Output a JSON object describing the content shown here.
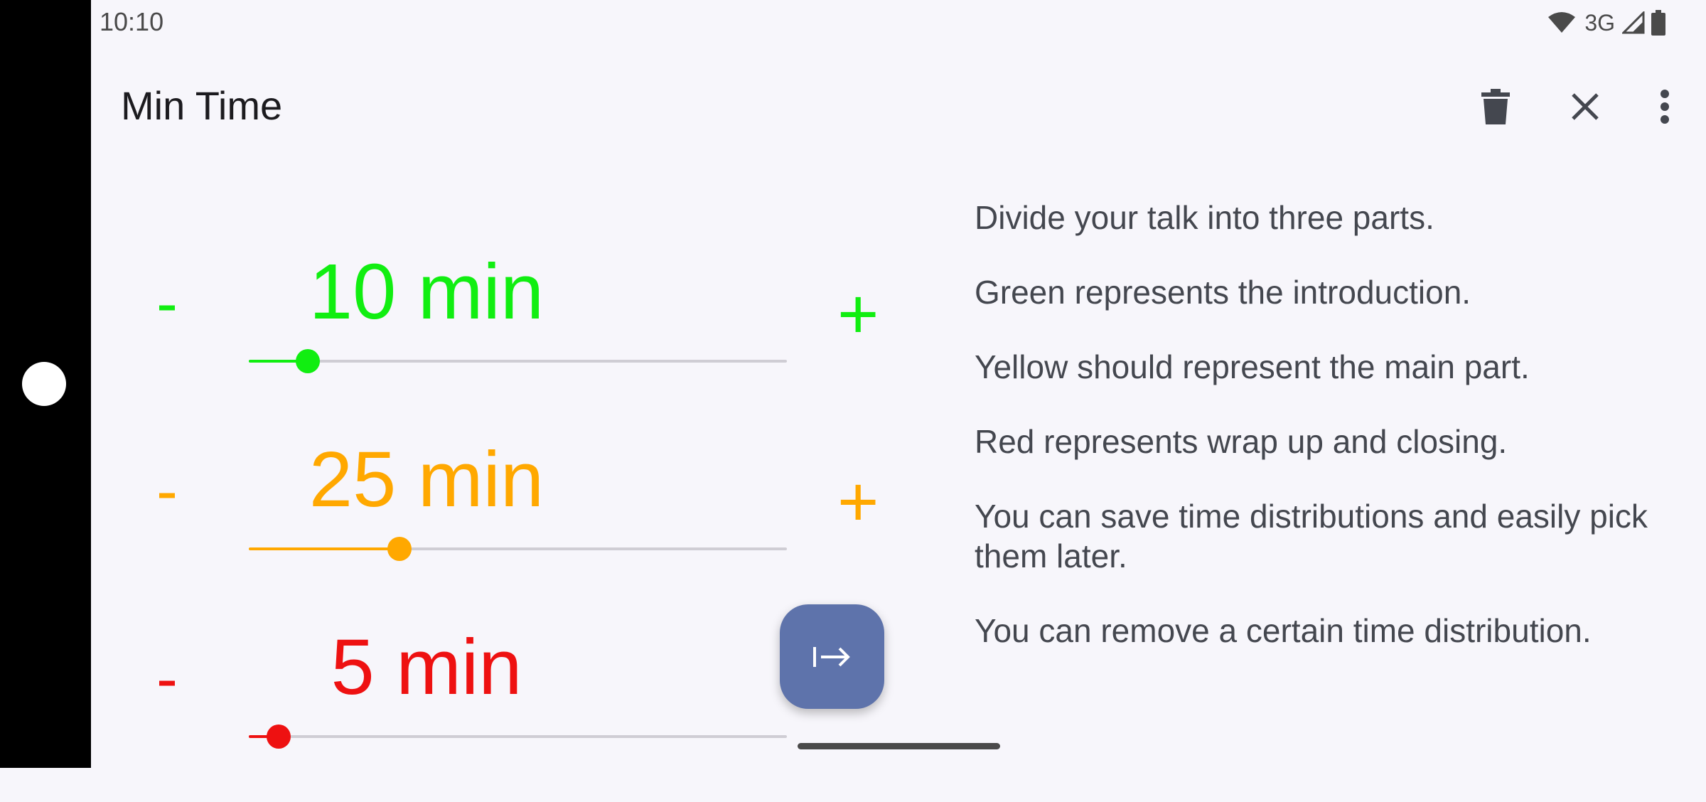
{
  "status_bar": {
    "time": "10:10",
    "network": "3G"
  },
  "app_bar": {
    "title": "Min Time",
    "icons": [
      "delete-icon",
      "close-icon",
      "more-vert-icon"
    ]
  },
  "sliders": [
    {
      "label": "10 min",
      "minus": "-",
      "plus": "+",
      "color": "#11ee11",
      "value_fraction": 0.11
    },
    {
      "label": "25 min",
      "minus": "-",
      "plus": "+",
      "color": "#ffa800",
      "value_fraction": 0.28
    },
    {
      "label": "5 min",
      "minus": "-",
      "plus": "+",
      "color": "#ee1111",
      "value_fraction": 0.055
    }
  ],
  "help": {
    "lines": [
      "Divide your talk into three parts.",
      "Green represents the introduction.",
      "Yellow should represent the main part.",
      "Red represents wrap up and closing.",
      "You can save time distributions and easily pick them later.",
      "You can remove a certain time distribution."
    ]
  },
  "fab": {
    "icon": "start-arrow-icon"
  }
}
